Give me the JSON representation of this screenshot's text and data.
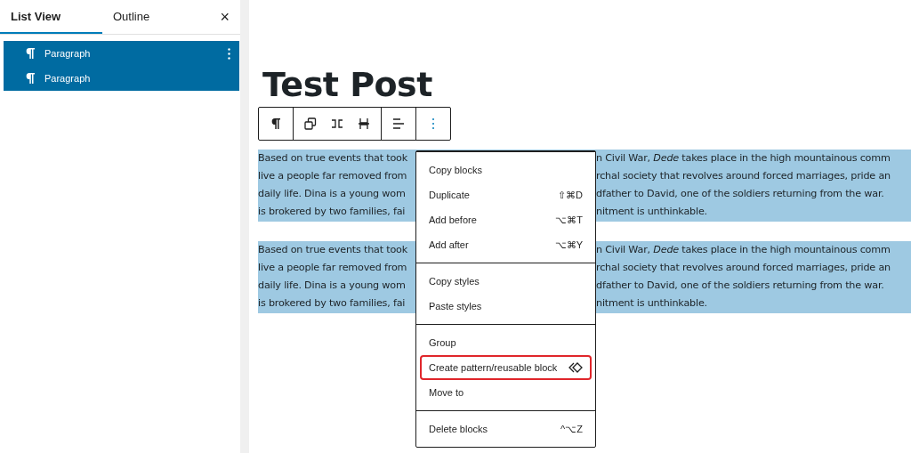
{
  "sidebar": {
    "tabs": [
      {
        "label": "List View",
        "selected": true
      },
      {
        "label": "Outline",
        "selected": false
      }
    ],
    "close": "×",
    "items": [
      {
        "label": "Paragraph",
        "selected": true,
        "has_options": true
      },
      {
        "label": "Paragraph",
        "selected": true,
        "has_options": false
      }
    ]
  },
  "post": {
    "title": "Test Post",
    "paragraphs": [
      {
        "selected": true,
        "lines": [
          {
            "left": "Based on true events that took",
            "right": "n Civil War, *Dede* takes place in the high mountainous comm"
          },
          {
            "left": "live a people far removed from",
            "right": "rchal society that revolves around forced marriages, pride an"
          },
          {
            "left": "daily life. Dina is a young wom",
            "right": "dfather to David, one of the soldiers returning from the war."
          },
          {
            "left": "is brokered by two families, fai",
            "right": "nitment is unthinkable."
          }
        ]
      },
      {
        "selected": true,
        "lines": [
          {
            "left": "Based on true events that took",
            "right": "n Civil War, *Dede* takes place in the high mountainous comm"
          },
          {
            "left": "live a people far removed from",
            "right": "rchal society that revolves around forced marriages, pride an"
          },
          {
            "left": "daily life. Dina is a young wom",
            "right": "dfather to David, one of the soldiers returning from the war."
          },
          {
            "left": "is brokered by two families, fai",
            "right": "nitment is unthinkable."
          }
        ]
      }
    ]
  },
  "menu": {
    "groups": [
      [
        {
          "label": "Copy blocks",
          "highlighted": false
        },
        {
          "label": "Duplicate",
          "shortcut": "⇧⌘D",
          "highlighted": false
        },
        {
          "label": "Add before",
          "shortcut": "⌥⌘T",
          "highlighted": false
        },
        {
          "label": "Add after",
          "shortcut": "⌥⌘Y",
          "highlighted": false
        }
      ],
      [
        {
          "label": "Copy styles",
          "highlighted": false
        },
        {
          "label": "Paste styles",
          "highlighted": false
        }
      ],
      [
        {
          "label": "Group",
          "highlighted": false
        },
        {
          "label": "Create pattern/reusable block",
          "kind": "reusable",
          "highlighted": true
        },
        {
          "label": "Move to",
          "highlighted": false
        }
      ],
      [
        {
          "label": "Delete blocks",
          "shortcut": "^⌥Z",
          "highlighted": false
        }
      ]
    ]
  }
}
